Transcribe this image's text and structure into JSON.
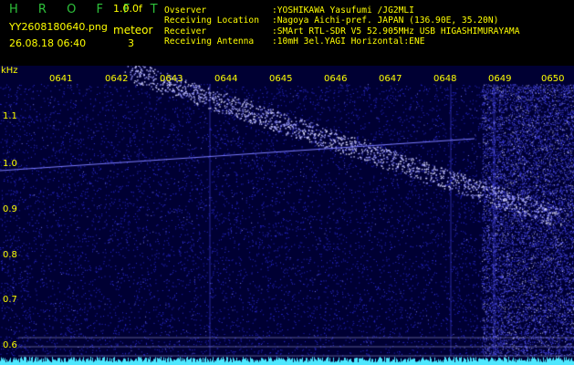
{
  "header": {
    "brand": "H R O F F T",
    "version": "1.0.0f",
    "filename": "YY2608180640.png",
    "datetime": "26.08.18 06:40",
    "meteor_label": "meteor",
    "meteor_count": "3",
    "info": [
      {
        "key": "Ovserver",
        "value": ":YOSHIKAWA Yasufumi /JG2MLI"
      },
      {
        "key": "Receiving Location",
        "value": ":Nagoya Aichi-pref. JAPAN (136.90E, 35.20N)"
      },
      {
        "key": "Receiver",
        "value": ":SMArt RTL-SDR V5 52.905MHz USB HIGASHIMURAYAMA"
      },
      {
        "key": "Receiving Antenna",
        "value": ":10mH 3el.YAGI Horizontal:ENE"
      }
    ]
  },
  "spectrogram": {
    "unit_label": "kHz",
    "y_ticks": [
      "1.1",
      "1.0",
      "0.9",
      "0.8",
      "0.7",
      "0.6"
    ],
    "x_ticks": [
      "0641",
      "0642",
      "0643",
      "0644",
      "0645",
      "0646",
      "0647",
      "0648",
      "0649",
      "0650"
    ],
    "colors": {
      "background": "#000033",
      "noise": "#2a2ad8",
      "bright": "#d8d8ff",
      "text": "#ffff00",
      "baseline": "#4fe8ff",
      "brand": "#2ec23a"
    }
  }
}
